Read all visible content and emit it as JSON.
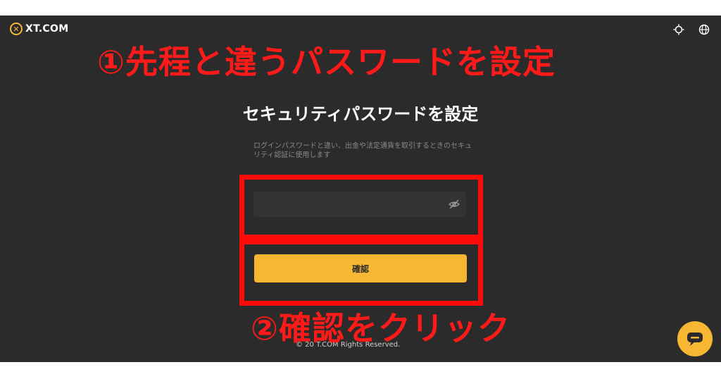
{
  "header": {
    "logo_mark": "✕",
    "logo_text": "XT.COM",
    "icons": [
      "theme-icon",
      "globe-icon"
    ]
  },
  "annotations": {
    "step1": "①先程と違うパスワードを設定",
    "step2": "②確認をクリック",
    "color": "#ff1a1a"
  },
  "main": {
    "title": "セキュリティパスワードを設定",
    "description": "ログインパスワードと違い、出金や法定通貨を取引するときのセキュリティ認証に使用します",
    "password_field": {
      "value": "",
      "placeholder": "",
      "icon": "eye-off-icon"
    },
    "confirm_label": "確認"
  },
  "footer": {
    "text": "© 20 T.COM Rights Reserved."
  },
  "colors": {
    "background": "#2b2b2b",
    "accent": "#f7b733",
    "highlight": "#ff0a0a"
  }
}
